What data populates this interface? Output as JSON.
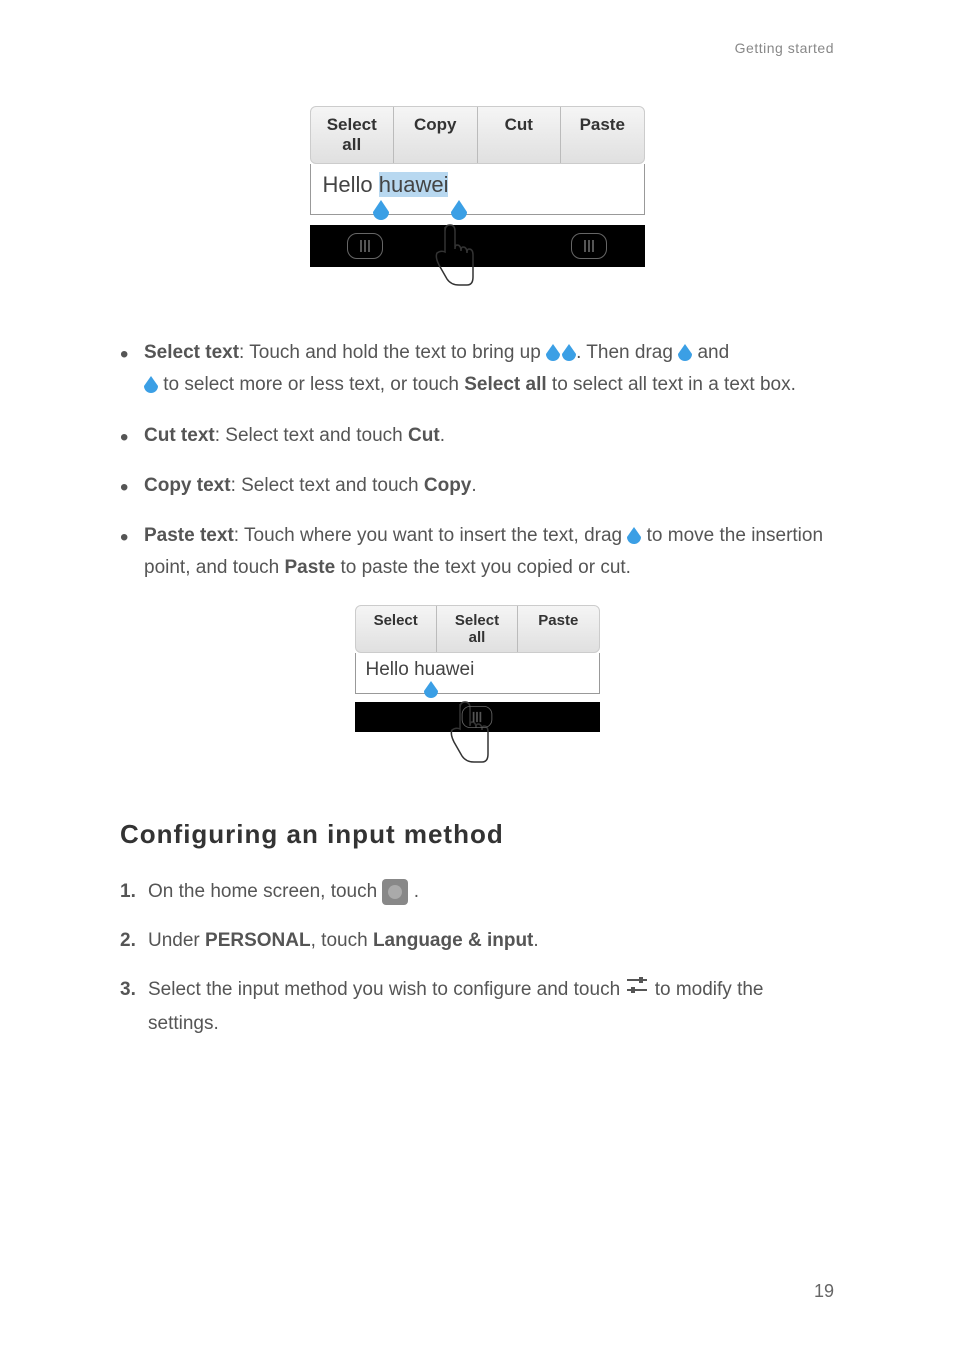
{
  "header": "Getting started",
  "figure1": {
    "buttons": [
      "Select all",
      "Copy",
      "Cut",
      "Paste"
    ],
    "text_prefix": "Hello ",
    "text_highlighted": "huawei"
  },
  "bullets": {
    "select": {
      "label": "Select text",
      "part1": ": Touch and hold the text to bring up ",
      "part2": ". Then drag ",
      "part3": " and ",
      "part4": " to select more or less text, or touch ",
      "bold1": "Select all",
      "part5": " to select all text in a text box."
    },
    "cut": {
      "label": "Cut text",
      "text": ": Select text and touch ",
      "bold": "Cut",
      "end": "."
    },
    "copy": {
      "label": "Copy text",
      "text": ": Select text and touch ",
      "bold": "Copy",
      "end": "."
    },
    "paste": {
      "label": "Paste text",
      "part1": ": Touch where you want to insert the text, drag ",
      "part2": " to move the insertion point, and touch ",
      "bold": "Paste",
      "part3": " to paste the text you copied or cut."
    }
  },
  "figure2": {
    "buttons": [
      "Select",
      "Select all",
      "Paste"
    ],
    "text": "Hello huawei"
  },
  "heading": "Configuring an input method",
  "steps": {
    "n1": "1.",
    "t1a": " On the home screen, touch ",
    "t1b": " .",
    "n2": "2.",
    "t2a": " Under ",
    "t2b": "PERSONAL",
    "t2c": ", touch ",
    "t2d": "Language & input",
    "t2e": ".",
    "n3": "3.",
    "t3a": " Select the input method you wish to configure and touch ",
    "t3b": " to modify the settings."
  },
  "page_number": "19"
}
